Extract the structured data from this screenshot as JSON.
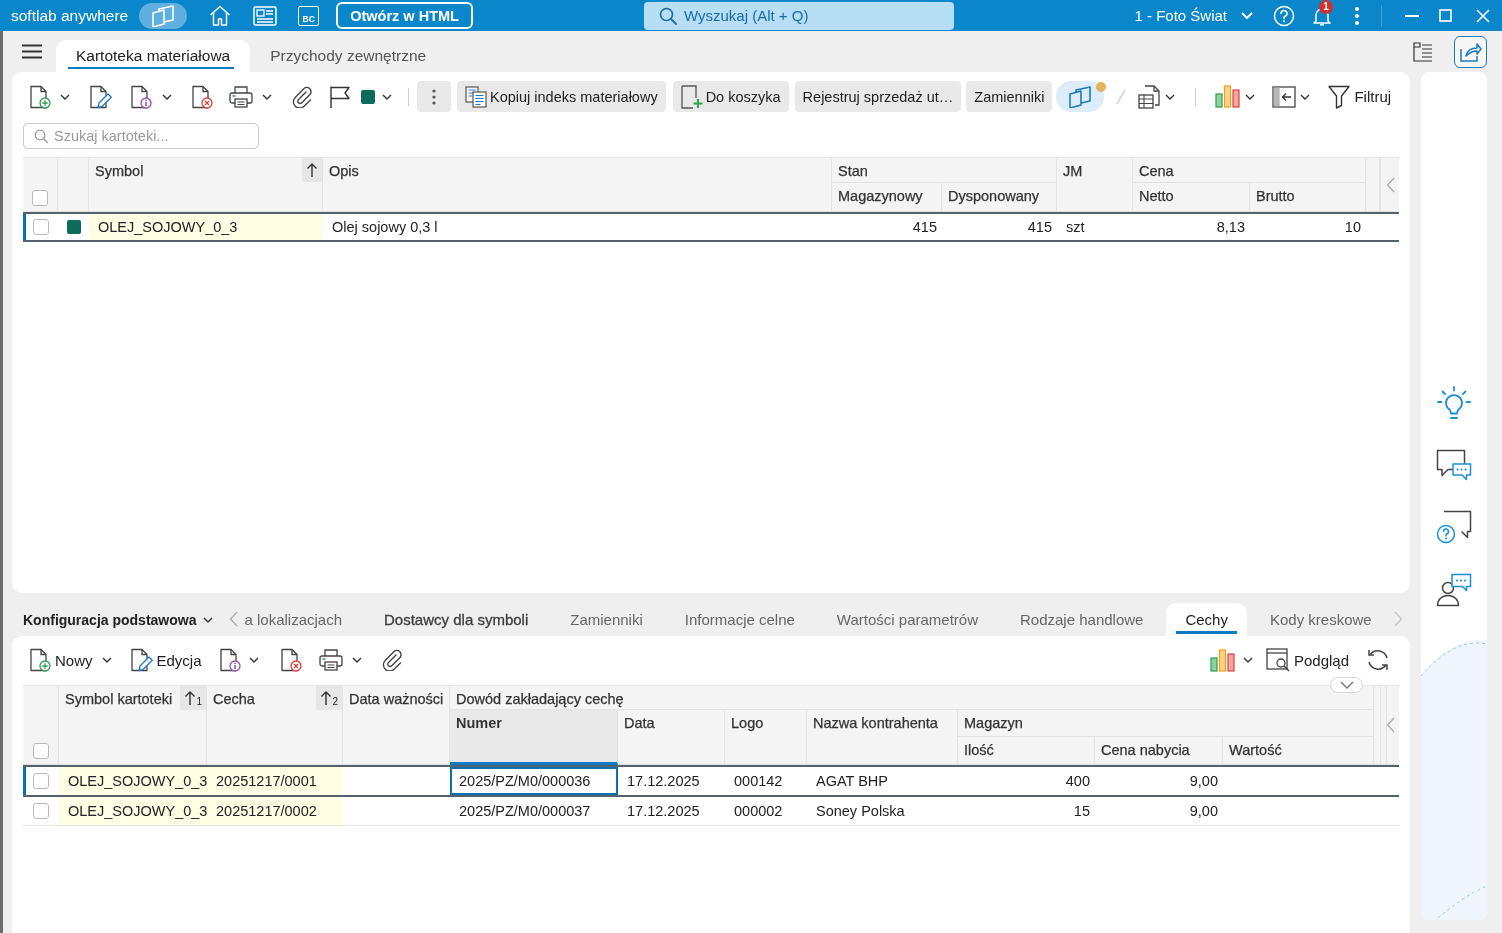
{
  "title_bar": {
    "brand": "softlab anywhere",
    "shortcut_badge": "BC",
    "open_button": "Otwórz w HTML",
    "search": {
      "placeholder": "Wyszukaj (Alt + Q)"
    },
    "company": "1 - Foto Świat",
    "notification_count": "1"
  },
  "tabs": [
    {
      "label": "Kartoteka materiałowa",
      "selected": true
    },
    {
      "label": "Przychody zewnętrzne",
      "selected": false
    }
  ],
  "toolbar": {
    "buttons": [
      "Kopiuj indeks materiałowy",
      "Do koszyka",
      "Rejestruj sprzedaż ut…",
      "Zamienniki"
    ],
    "filter": "Filtruj"
  },
  "search": {
    "placeholder": "Szukaj kartoteki..."
  },
  "items_table": {
    "all_checked": false,
    "columns": [
      {
        "label": "Symbol",
        "sorted": true
      },
      {
        "label": "Opis",
        "sorted": false
      },
      {
        "label": "Stan",
        "columns": [
          {
            "label": "Magazynowy",
            "sorted": false
          },
          {
            "label": "Dysponowany",
            "sorted": false
          }
        ]
      },
      {
        "label": "JM",
        "sorted": false
      },
      {
        "label": "Cena",
        "columns": [
          {
            "label": "Netto",
            "sorted": false
          },
          {
            "label": "Brutto",
            "sorted": false
          }
        ]
      }
    ],
    "rows": [
      {
        "checked": false,
        "selected": true,
        "color": "#0e6b5a",
        "cells": [
          "OLEJ_SOJOWY_0_3",
          "Olej sojowy 0,3 l",
          [
            "415",
            "415"
          ],
          "szt",
          [
            "8,13",
            "10"
          ]
        ]
      }
    ]
  },
  "detail_tabs": {
    "config": "Konfiguracja podstawowa",
    "tabs": [
      {
        "label": "a lokalizacjach",
        "selected": false,
        "emphasized": false
      },
      {
        "label": "Dostawcy dla symboli",
        "selected": false,
        "emphasized": true
      },
      {
        "label": "Zamienniki",
        "selected": false,
        "emphasized": false
      },
      {
        "label": "Informacje celne",
        "selected": false,
        "emphasized": false
      },
      {
        "label": "Wartości parametrów",
        "selected": false,
        "emphasized": false
      },
      {
        "label": "Rodzaje handlowe",
        "selected": false,
        "emphasized": false
      },
      {
        "label": "Cechy",
        "selected": true,
        "emphasized": false
      },
      {
        "label": "Kody kreskowe",
        "selected": false,
        "emphasized": false
      }
    ]
  },
  "detail_toolbar": {
    "new": "Nowy",
    "edit": "Edycja",
    "preview": "Podgląd"
  },
  "features_table": {
    "all_checked": false,
    "columns": [
      {
        "label": "Symbol kartoteki",
        "sorted": true,
        "sort_order": "1",
        "focused": false
      },
      {
        "label": "Cecha",
        "sorted": true,
        "sort_order": "2",
        "focused": false
      },
      {
        "label": "Data ważności",
        "sorted": false,
        "focused": false
      },
      {
        "label": "Dowód zakładający cechę",
        "columns": [
          {
            "label": "Numer",
            "sorted": false,
            "focused": true
          },
          {
            "label": "Data",
            "sorted": false,
            "focused": false
          },
          {
            "label": "Logo",
            "sorted": false,
            "focused": false
          },
          {
            "label": "Nazwa kontrahenta",
            "sorted": false,
            "focused": false
          },
          {
            "label": "Magazyn",
            "columns": [
              {
                "label": "Ilość",
                "sorted": false,
                "focused": false
              },
              {
                "label": "Cena nabycia",
                "sorted": false,
                "focused": false
              },
              {
                "label": "Wartość",
                "sorted": false,
                "focused": false
              }
            ]
          }
        ]
      }
    ],
    "rows": [
      {
        "checked": false,
        "selected": true,
        "cells": [
          "OLEJ_SOJOWY_0_3",
          "20251217/0001",
          "",
          [
            "2025/PZ/M0/000036",
            "17.12.2025",
            "000142",
            "AGAT BHP",
            [
              "400",
              "9,00",
              ""
            ]
          ]
        ]
      },
      {
        "checked": false,
        "selected": false,
        "cells": [
          "OLEJ_SOJOWY_0_3",
          "20251217/0002",
          "",
          [
            "2025/PZ/M0/000037",
            "17.12.2025",
            "000002",
            "Soney Polska",
            [
              "15",
              "9,00",
              ""
            ]
          ]
        ]
      }
    ]
  }
}
